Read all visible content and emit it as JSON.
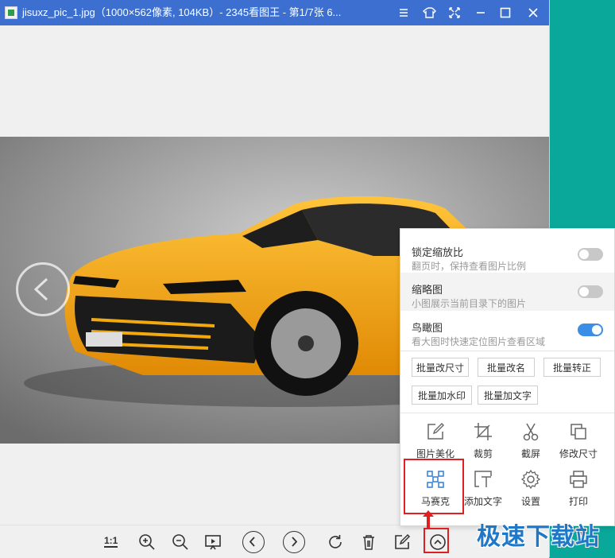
{
  "window": {
    "title": "jisuxz_pic_1.jpg（1000×562像素, 104KB）- 2345看图王 - 第1/7张 6..."
  },
  "titlebar_controls": [
    "menu-icon",
    "skin-icon",
    "fullscreen-icon",
    "minimize-icon",
    "maximize-icon",
    "close-icon"
  ],
  "popup": {
    "options": [
      {
        "title": "锁定缩放比",
        "desc": "翻页时，保持查看图片比例",
        "on": false
      },
      {
        "title": "缩略图",
        "desc": "小图展示当前目录下的图片",
        "on": false
      },
      {
        "title": "鸟瞰图",
        "desc": "看大图时快速定位图片查看区域",
        "on": true
      }
    ],
    "batch_buttons": [
      "批量改尺寸",
      "批量改名",
      "批量转正",
      "批量加水印",
      "批量加文字"
    ],
    "tools": [
      {
        "label": "图片美化",
        "icon": "edit-icon"
      },
      {
        "label": "裁剪",
        "icon": "crop-icon"
      },
      {
        "label": "截屏",
        "icon": "scissors-icon"
      },
      {
        "label": "修改尺寸",
        "icon": "resize-icon"
      },
      {
        "label": "马赛克",
        "icon": "mosaic-icon"
      },
      {
        "label": "添加文字",
        "icon": "text-icon"
      },
      {
        "label": "设置",
        "icon": "gear-icon"
      },
      {
        "label": "打印",
        "icon": "printer-icon"
      }
    ]
  },
  "toolbar": {
    "actual_size_label": "1:1",
    "buttons": [
      "actual-size",
      "zoom-in-icon",
      "zoom-out-icon",
      "slideshow-icon",
      "previous-icon",
      "next-icon",
      "rotate-icon",
      "delete-icon",
      "edit-icon",
      "more-icon"
    ]
  },
  "watermark": "极速下载站",
  "colors": {
    "titlebar": "#3c6fd0",
    "toggle_on": "#3a8ee6",
    "highlight": "#e02020",
    "car": "#f2a90f",
    "desktop": "#0aa89a"
  }
}
